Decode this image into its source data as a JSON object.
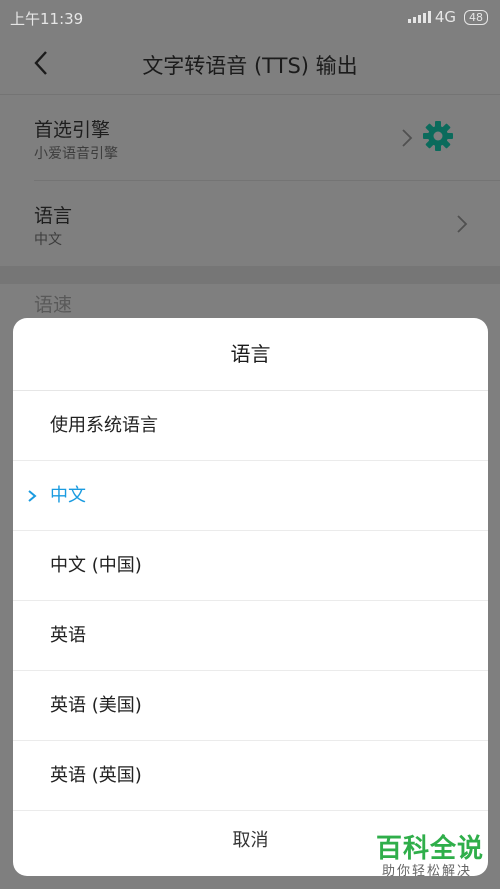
{
  "status_bar": {
    "time": "上午11:39",
    "network": "4G",
    "battery": "48"
  },
  "header": {
    "title": "文字转语音 (TTS) 输出"
  },
  "settings": {
    "preferred_engine": {
      "title": "首选引擎",
      "value": "小爱语音引擎"
    },
    "language": {
      "title": "语言",
      "value": "中文"
    },
    "speech_rate": {
      "title": "语速"
    }
  },
  "dialog": {
    "title": "语言",
    "options": [
      {
        "label": "使用系统语言",
        "selected": false
      },
      {
        "label": "中文",
        "selected": true
      },
      {
        "label": "中文 (中国)",
        "selected": false
      },
      {
        "label": "英语",
        "selected": false
      },
      {
        "label": "英语 (美国)",
        "selected": false
      },
      {
        "label": "英语 (英国)",
        "selected": false
      }
    ],
    "cancel_label": "取消"
  },
  "watermark": {
    "brand": "百科全说",
    "slogan": "助你轻松解决"
  },
  "colors": {
    "accent": "#1a9be0",
    "gear": "#0b6b5c",
    "watermark": "#2fae4a"
  }
}
